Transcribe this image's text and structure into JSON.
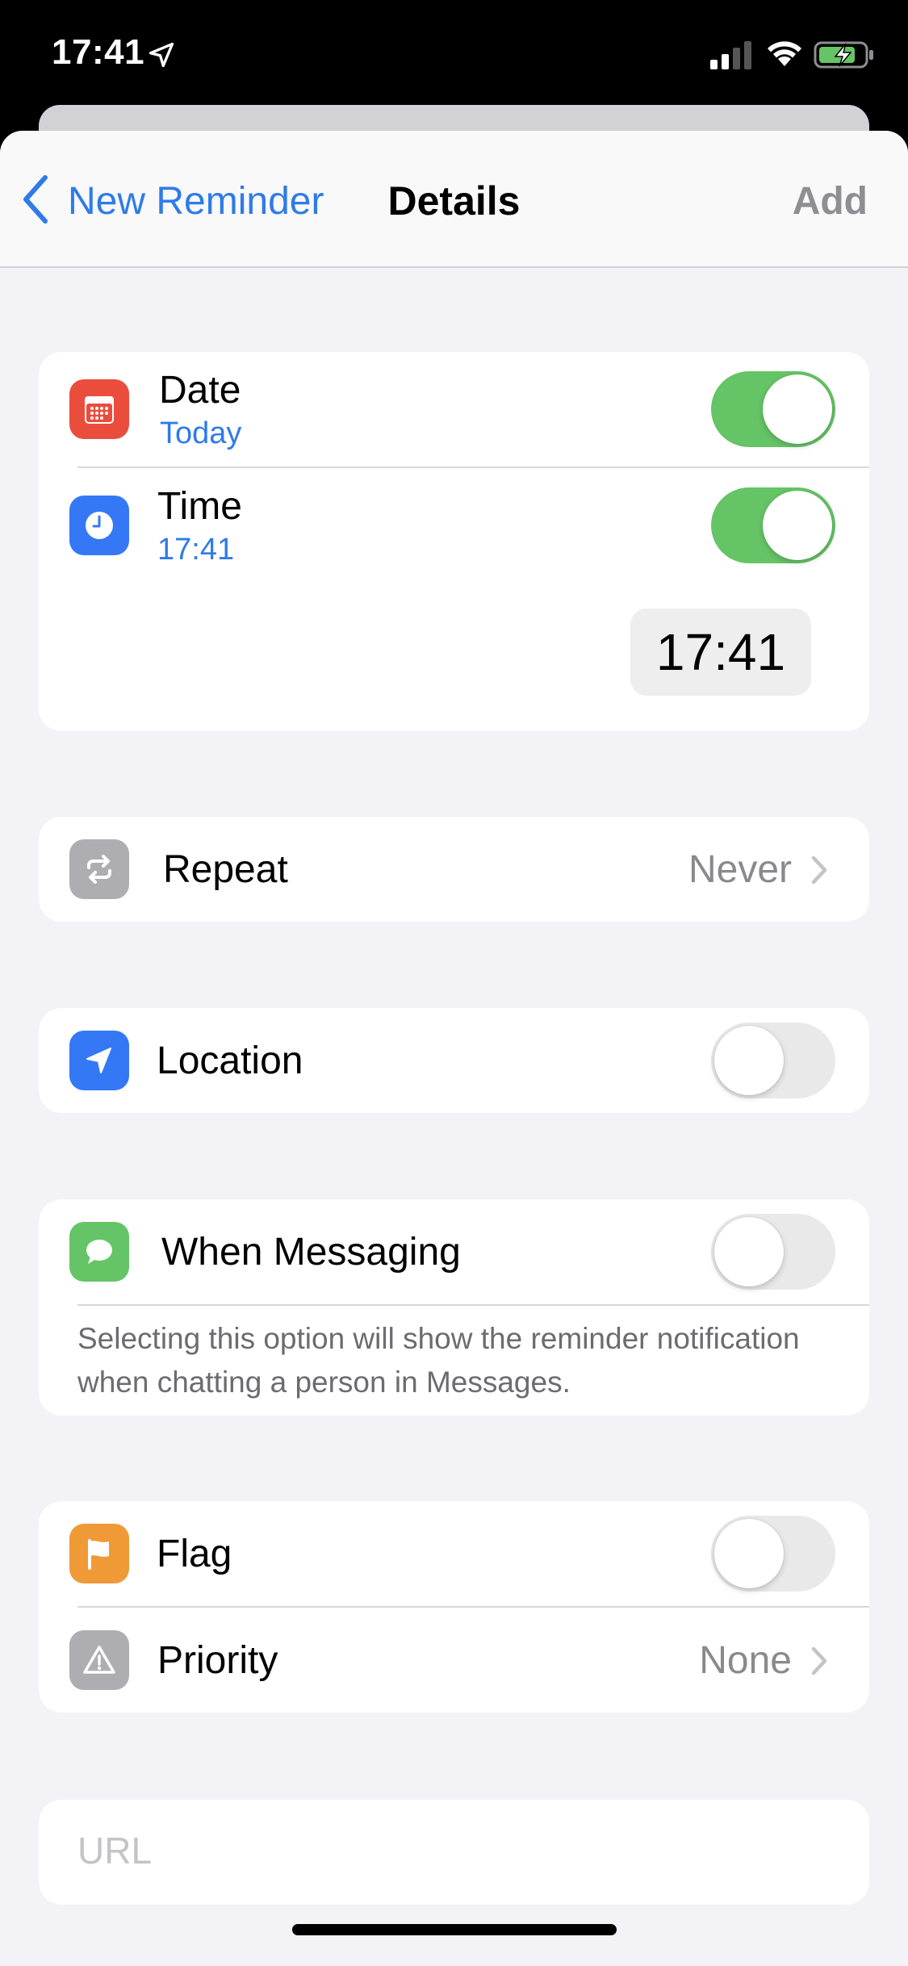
{
  "status_bar": {
    "time": "17:41"
  },
  "nav": {
    "back_label": "New Reminder",
    "title": "Details",
    "add_label": "Add"
  },
  "date_row": {
    "label": "Date",
    "value": "Today",
    "toggle_on": true,
    "icon": "calendar-icon",
    "icon_color": "#eb4d3d"
  },
  "time_row": {
    "label": "Time",
    "value": "17:41",
    "toggle_on": true,
    "picker_value": "17:41",
    "icon": "clock-icon",
    "icon_color": "#3478f6"
  },
  "repeat_row": {
    "label": "Repeat",
    "value": "Never",
    "icon": "repeat-icon",
    "icon_color": "#aeaeb2"
  },
  "location_row": {
    "label": "Location",
    "toggle_on": false,
    "icon": "location-arrow-icon",
    "icon_color": "#3478f6"
  },
  "messaging_row": {
    "label": "When Messaging",
    "toggle_on": false,
    "footnote": "Selecting this option will show the reminder notification when chatting a person in Messages.",
    "icon": "message-bubble-icon",
    "icon_color": "#65c466"
  },
  "flag_row": {
    "label": "Flag",
    "toggle_on": false,
    "icon": "flag-icon",
    "icon_color": "#f09a37"
  },
  "priority_row": {
    "label": "Priority",
    "value": "None",
    "icon": "warning-triangle-icon",
    "icon_color": "#aeaeb2"
  },
  "url_field": {
    "placeholder": "URL",
    "value": ""
  },
  "colors": {
    "accent": "#2f7be8",
    "toggle_on": "#65c466",
    "background": "#f2f2f7"
  }
}
